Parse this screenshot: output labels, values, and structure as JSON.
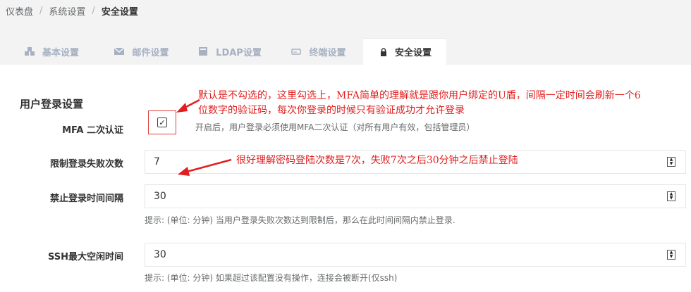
{
  "breadcrumb": {
    "items": [
      "仪表盘",
      "系统设置",
      "安全设置"
    ],
    "separator": "/"
  },
  "tabs": [
    {
      "label": "基本设置",
      "icon": "cubes-icon",
      "active": false
    },
    {
      "label": "邮件设置",
      "icon": "envelope-icon",
      "active": false
    },
    {
      "label": "LDAP设置",
      "icon": "database-icon",
      "active": false
    },
    {
      "label": "终端设置",
      "icon": "hdd-icon",
      "active": false
    },
    {
      "label": "安全设置",
      "icon": "lock-icon",
      "active": true
    }
  ],
  "section": {
    "title": "用户登录设置"
  },
  "fields": {
    "mfa": {
      "label": "MFA 二次认证",
      "checked": true,
      "check_glyph": "✓",
      "hint": "开启后，用户登录必须使用MFA二次认证（对所有用户有效，包括管理员）"
    },
    "login_limit": {
      "label": "限制登录失败次数",
      "value": "7"
    },
    "block_interval": {
      "label": "禁止登录时间间隔",
      "value": "30",
      "hint": "提示: (单位: 分钟) 当用户登录失败次数达到限制后，那么在此时间间隔内禁止登录."
    },
    "ssh_idle": {
      "label": "SSH最大空闲时间",
      "value": "30",
      "hint": "提示: (单位: 分钟) 如果超过该配置没有操作，连接会被断开(仅ssh)"
    }
  },
  "annotations": {
    "mfa_line1": "默认是不勾选的，这里勾选上，MFA简单的理解就是跟你用户绑定的U盾，间隔一定时间会刷新一个6",
    "mfa_line2": "位数字的验证码，每次你登录的时候只有验证成功才允许登录",
    "login_note": "很好理解密码登陆次数是7次，失败7次之后30分钟之后禁止登陆"
  },
  "colors": {
    "accent_red": "#e02020",
    "page_bg": "#f3f3f4",
    "tab_inactive": "#a7b1c2"
  }
}
